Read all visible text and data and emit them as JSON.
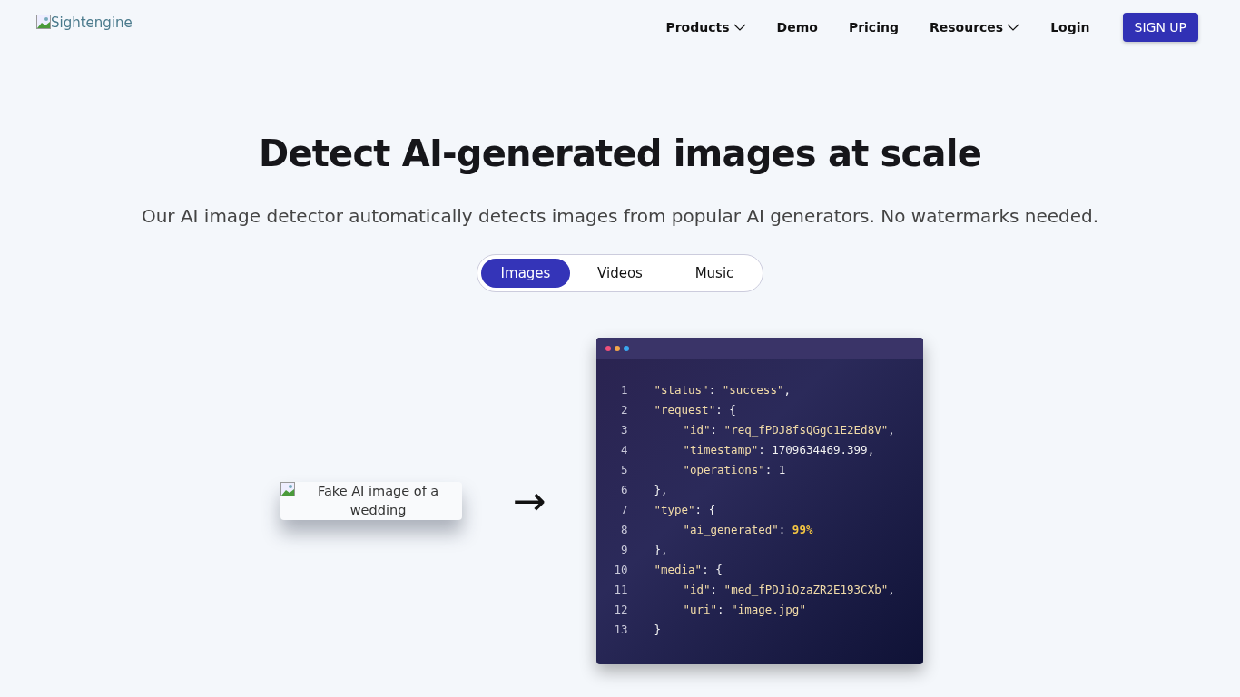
{
  "logo": {
    "alt": "Sightengine"
  },
  "nav": [
    {
      "label": "Products",
      "dropdown": true
    },
    {
      "label": "Demo",
      "dropdown": false
    },
    {
      "label": "Pricing",
      "dropdown": false
    },
    {
      "label": "Resources",
      "dropdown": true
    },
    {
      "label": "Login",
      "dropdown": false
    }
  ],
  "signup": "SIGN UP",
  "headline": "Detect AI-generated images at scale",
  "subtitle": "Our AI image detector automatically detects images from popular AI generators. No watermarks needed.",
  "tabs": [
    {
      "label": "Images",
      "selected": true
    },
    {
      "label": "Videos",
      "selected": false
    },
    {
      "label": "Music",
      "selected": false
    }
  ],
  "image_alt": "Fake AI image of a wedding",
  "arrow": "→",
  "code": [
    {
      "number": "1",
      "indented": false,
      "tokens": [
        {
          "kind": "key",
          "text": "\"status\""
        },
        {
          "kind": "punct",
          "text": ": "
        },
        {
          "kind": "string",
          "text": "\"success\""
        },
        {
          "kind": "punct",
          "text": ","
        }
      ]
    },
    {
      "number": "2",
      "indented": false,
      "tokens": [
        {
          "kind": "key",
          "text": "\"request\""
        },
        {
          "kind": "punct",
          "text": ": {"
        }
      ]
    },
    {
      "number": "3",
      "indented": true,
      "tokens": [
        {
          "kind": "key",
          "text": "\"id\""
        },
        {
          "kind": "punct",
          "text": ": "
        },
        {
          "kind": "string",
          "text": "\"req_fPDJ8fsQGgC1E2Ed8V\""
        },
        {
          "kind": "punct",
          "text": ","
        }
      ]
    },
    {
      "number": "4",
      "indented": true,
      "tokens": [
        {
          "kind": "key",
          "text": "\"timestamp\""
        },
        {
          "kind": "punct",
          "text": ": 1709634469.399,"
        }
      ]
    },
    {
      "number": "5",
      "indented": true,
      "tokens": [
        {
          "kind": "key",
          "text": "\"operations\""
        },
        {
          "kind": "punct",
          "text": ": 1"
        }
      ]
    },
    {
      "number": "6",
      "indented": false,
      "tokens": [
        {
          "kind": "punct",
          "text": "},"
        }
      ]
    },
    {
      "number": "7",
      "indented": false,
      "tokens": [
        {
          "kind": "key",
          "text": "\"type\""
        },
        {
          "kind": "punct",
          "text": ": {"
        }
      ]
    },
    {
      "number": "8",
      "indented": true,
      "tokens": [
        {
          "kind": "key",
          "text": "\"ai_generated\""
        },
        {
          "kind": "punct",
          "text": ": "
        },
        {
          "kind": "highlight",
          "text": "99%"
        }
      ]
    },
    {
      "number": "9",
      "indented": false,
      "tokens": [
        {
          "kind": "punct",
          "text": "},"
        }
      ]
    },
    {
      "number": "10",
      "indented": false,
      "tokens": [
        {
          "kind": "key",
          "text": "\"media\""
        },
        {
          "kind": "punct",
          "text": ": {"
        }
      ]
    },
    {
      "number": "11",
      "indented": true,
      "tokens": [
        {
          "kind": "key",
          "text": "\"id\""
        },
        {
          "kind": "punct",
          "text": ": "
        },
        {
          "kind": "string",
          "text": "\"med_fPDJiQzaZR2E193CXb\""
        },
        {
          "kind": "punct",
          "text": ","
        }
      ]
    },
    {
      "number": "12",
      "indented": true,
      "tokens": [
        {
          "kind": "key",
          "text": "\"uri\""
        },
        {
          "kind": "punct",
          "text": ": "
        },
        {
          "kind": "string",
          "text": "\"image.jpg\""
        }
      ]
    },
    {
      "number": "13",
      "indented": false,
      "tokens": [
        {
          "kind": "punct",
          "text": "}"
        }
      ]
    }
  ]
}
